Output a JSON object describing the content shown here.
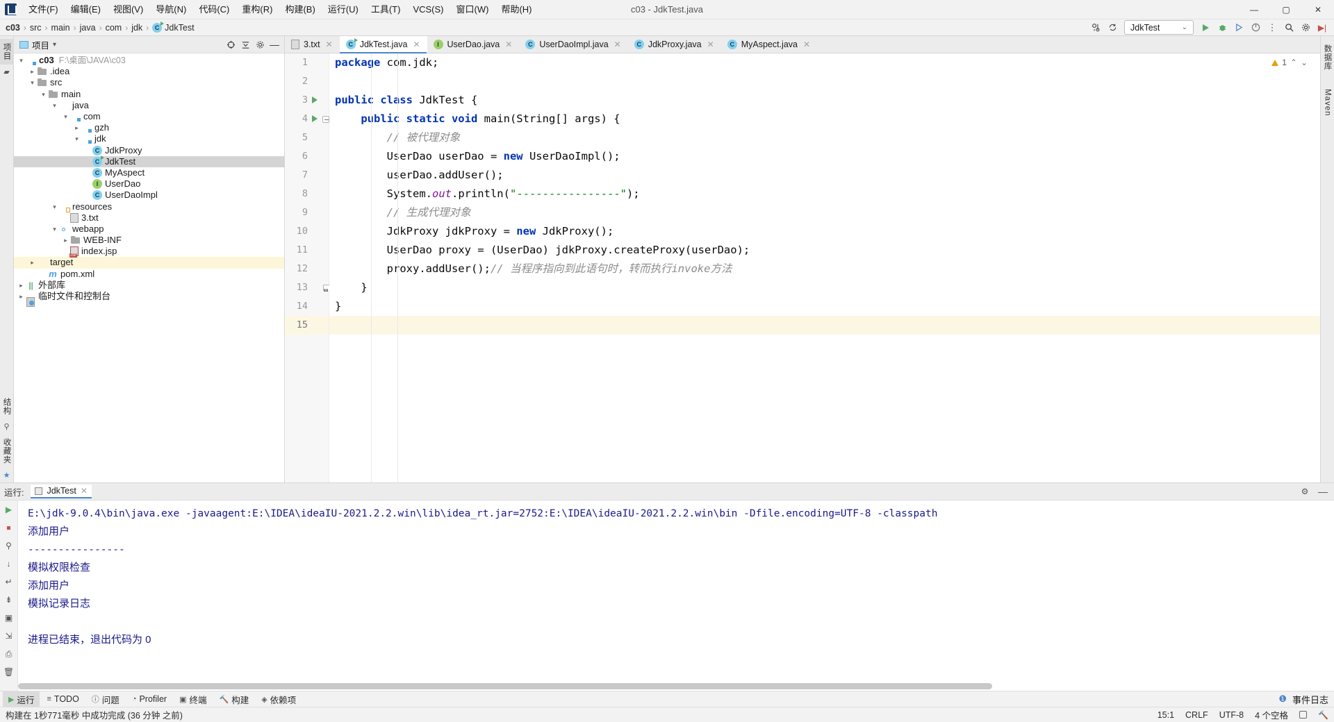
{
  "window": {
    "title": "c03 - JdkTest.java",
    "minimize": "—",
    "maximize": "▢",
    "close": "✕"
  },
  "menu": {
    "items": [
      {
        "label": "文件(F)",
        "name": "menu-file"
      },
      {
        "label": "编辑(E)",
        "name": "menu-edit"
      },
      {
        "label": "视图(V)",
        "name": "menu-view"
      },
      {
        "label": "导航(N)",
        "name": "menu-navigate"
      },
      {
        "label": "代码(C)",
        "name": "menu-code"
      },
      {
        "label": "重构(R)",
        "name": "menu-refactor"
      },
      {
        "label": "构建(B)",
        "name": "menu-build"
      },
      {
        "label": "运行(U)",
        "name": "menu-run"
      },
      {
        "label": "工具(T)",
        "name": "menu-tools"
      },
      {
        "label": "VCS(S)",
        "name": "menu-vcs"
      },
      {
        "label": "窗口(W)",
        "name": "menu-window"
      },
      {
        "label": "帮助(H)",
        "name": "menu-help"
      }
    ]
  },
  "breadcrumb": {
    "items": [
      "c03",
      "src",
      "main",
      "java",
      "com",
      "jdk",
      "JdkTest"
    ],
    "separator": "›"
  },
  "navbar_right": {
    "run_config": "JdkTest",
    "chevron": "⌄",
    "icons": [
      {
        "name": "settings-sync-icon",
        "glyph": "⇅"
      },
      {
        "name": "search-everywhere-icon",
        "glyph": "🔍"
      },
      {
        "name": "run-icon",
        "glyph": "▶"
      },
      {
        "name": "debug-icon",
        "glyph": "🐞"
      },
      {
        "name": "run-coverage-icon",
        "glyph": "▶"
      },
      {
        "name": "profiler-icon",
        "glyph": "◉"
      },
      {
        "name": "more-icon",
        "glyph": "⋮"
      },
      {
        "name": "settings-icon",
        "glyph": "⚙"
      },
      {
        "name": "updates-icon",
        "glyph": "↻"
      }
    ]
  },
  "left_strip": {
    "project_tab": "项目",
    "structure_tab": "结构",
    "favorites_tab": "收藏夹"
  },
  "right_strip": {
    "database_tab": "数据库",
    "maven_tab": "Maven"
  },
  "project_panel": {
    "title": "项目",
    "dropdown": "▾",
    "actions": [
      {
        "name": "select-opened-file-icon",
        "glyph": "⊕"
      },
      {
        "name": "collapse-all-icon",
        "glyph": "⇱"
      },
      {
        "name": "settings-icon",
        "glyph": "⚙"
      },
      {
        "name": "hide-icon",
        "glyph": "—"
      }
    ],
    "tree": [
      {
        "label": "c03",
        "path": "F:\\桌面\\JAVA\\c03",
        "icon": "folder-mod",
        "indent": 0,
        "arrow": "⌄",
        "bold": true
      },
      {
        "label": ".idea",
        "icon": "folder",
        "indent": 1,
        "arrow": "›"
      },
      {
        "label": "src",
        "icon": "folder",
        "indent": 1,
        "arrow": "⌄"
      },
      {
        "label": "main",
        "icon": "folder",
        "indent": 2,
        "arrow": "⌄"
      },
      {
        "label": "java",
        "icon": "folder-src",
        "indent": 3,
        "arrow": "⌄"
      },
      {
        "label": "com",
        "icon": "folder-mod",
        "indent": 4,
        "arrow": "⌄"
      },
      {
        "label": "gzh",
        "icon": "folder-mod",
        "indent": 5,
        "arrow": "›"
      },
      {
        "label": "jdk",
        "icon": "folder-mod",
        "indent": 5,
        "arrow": "⌄"
      },
      {
        "label": "JdkProxy",
        "icon": "class",
        "indent": 6,
        "arrow": ""
      },
      {
        "label": "JdkTest",
        "icon": "class-runnable",
        "indent": 6,
        "arrow": "",
        "selected": true
      },
      {
        "label": "MyAspect",
        "icon": "class",
        "indent": 6,
        "arrow": ""
      },
      {
        "label": "UserDao",
        "icon": "interface",
        "indent": 6,
        "arrow": ""
      },
      {
        "label": "UserDaoImpl",
        "icon": "class",
        "indent": 6,
        "arrow": ""
      },
      {
        "label": "resources",
        "icon": "folder-res",
        "indent": 3,
        "arrow": "⌄"
      },
      {
        "label": "3.txt",
        "icon": "file",
        "indent": 4,
        "arrow": ""
      },
      {
        "label": "webapp",
        "icon": "folder-web",
        "indent": 3,
        "arrow": "⌄"
      },
      {
        "label": "WEB-INF",
        "icon": "folder",
        "indent": 4,
        "arrow": "›"
      },
      {
        "label": "index.jsp",
        "icon": "jsp",
        "indent": 4,
        "arrow": ""
      },
      {
        "label": "target",
        "icon": "folder-orange",
        "indent": 1,
        "arrow": "›",
        "highlight": true
      },
      {
        "label": "pom.xml",
        "icon": "maven",
        "indent": 2,
        "arrow": ""
      },
      {
        "label": "外部库",
        "icon": "library",
        "indent": 0,
        "arrow": "›"
      },
      {
        "label": "临时文件和控制台",
        "icon": "scratch",
        "indent": 0,
        "arrow": "›"
      }
    ]
  },
  "editor_tabs": [
    {
      "label": "3.txt",
      "icon": "file",
      "active": false
    },
    {
      "label": "JdkTest.java",
      "icon": "class-runnable",
      "active": true
    },
    {
      "label": "UserDao.java",
      "icon": "interface",
      "active": false
    },
    {
      "label": "UserDaoImpl.java",
      "icon": "class",
      "active": false
    },
    {
      "label": "JdkProxy.java",
      "icon": "class",
      "active": false
    },
    {
      "label": "MyAspect.java",
      "icon": "class",
      "active": false
    }
  ],
  "editor": {
    "warning_count": "1",
    "warning_up": "⌃",
    "warning_down": "⌄",
    "lines": [
      {
        "n": "1",
        "segments": [
          {
            "t": "package",
            "c": "kw"
          },
          {
            "t": " com.jdk;",
            "c": "plain"
          }
        ]
      },
      {
        "n": "2",
        "segments": []
      },
      {
        "n": "3",
        "run": true,
        "segments": [
          {
            "t": "public class ",
            "c": "kw"
          },
          {
            "t": "JdkTest ",
            "c": "plain"
          },
          {
            "t": "{",
            "c": "plain"
          }
        ]
      },
      {
        "n": "4",
        "run": true,
        "fold": true,
        "segments": [
          {
            "t": "    public static void ",
            "c": "kw"
          },
          {
            "t": "main(String[] args) {",
            "c": "plain"
          }
        ]
      },
      {
        "n": "5",
        "segments": [
          {
            "t": "        // 被代理对象",
            "c": "cmt"
          }
        ]
      },
      {
        "n": "6",
        "segments": [
          {
            "t": "        UserDao userDao = ",
            "c": "plain"
          },
          {
            "t": "new",
            "c": "kw"
          },
          {
            "t": " UserDaoImpl();",
            "c": "plain"
          }
        ]
      },
      {
        "n": "7",
        "segments": [
          {
            "t": "        userDao.addUser();",
            "c": "plain"
          }
        ]
      },
      {
        "n": "8",
        "segments": [
          {
            "t": "        System.",
            "c": "plain"
          },
          {
            "t": "out",
            "c": "fld"
          },
          {
            "t": ".println(",
            "c": "plain"
          },
          {
            "t": "\"----------------\"",
            "c": "str"
          },
          {
            "t": ");",
            "c": "plain"
          }
        ]
      },
      {
        "n": "9",
        "segments": [
          {
            "t": "        // 生成代理对象",
            "c": "cmt"
          }
        ]
      },
      {
        "n": "10",
        "segments": [
          {
            "t": "        JdkProxy jdkProxy = ",
            "c": "plain"
          },
          {
            "t": "new",
            "c": "kw"
          },
          {
            "t": " JdkProxy();",
            "c": "plain"
          }
        ]
      },
      {
        "n": "11",
        "segments": [
          {
            "t": "        UserDao proxy = (UserDao) jdkProxy.createProxy(userDao);",
            "c": "plain"
          }
        ]
      },
      {
        "n": "12",
        "segments": [
          {
            "t": "        proxy.addUser();",
            "c": "plain"
          },
          {
            "t": "// 当程序指向到此语句时，转而执行invoke方法",
            "c": "cmt"
          }
        ]
      },
      {
        "n": "13",
        "foldend": true,
        "segments": [
          {
            "t": "    }",
            "c": "plain"
          }
        ]
      },
      {
        "n": "14",
        "segments": [
          {
            "t": "}",
            "c": "plain"
          }
        ]
      },
      {
        "n": "15",
        "cur": true,
        "segments": []
      }
    ]
  },
  "run_panel": {
    "label": "运行:",
    "tab": "JdkTest",
    "tab_close": "✕",
    "settings_icon": "⚙",
    "hide_icon": "—",
    "toolbar": [
      {
        "name": "rerun-icon",
        "glyph": "▶",
        "color": "green"
      },
      {
        "name": "stop-icon",
        "glyph": "⏹",
        "color": "red"
      },
      {
        "name": "pin-icon",
        "glyph": "⚲"
      },
      {
        "name": "scroll-down-icon",
        "glyph": "↓"
      },
      {
        "name": "soft-wrap-icon",
        "glyph": "↵"
      },
      {
        "name": "print-settings-icon",
        "glyph": "⇟"
      },
      {
        "name": "screenshot-icon",
        "glyph": "▣"
      },
      {
        "name": "export-icon",
        "glyph": "⇲"
      },
      {
        "name": "print-icon",
        "glyph": "⎙"
      },
      {
        "name": "clear-all-icon",
        "glyph": "🗑"
      }
    ],
    "console_lines": [
      {
        "text": "E:\\jdk-9.0.4\\bin\\java.exe -javaagent:E:\\IDEA\\ideaIU-2021.2.2.win\\lib\\idea_rt.jar=2752:E:\\IDEA\\ideaIU-2021.2.2.win\\bin -Dfile.encoding=UTF-8 -classpath",
        "cjk": false
      },
      {
        "text": "添加用户",
        "cjk": true
      },
      {
        "text": "----------------",
        "cjk": false
      },
      {
        "text": "模拟权限检查",
        "cjk": true
      },
      {
        "text": "添加用户",
        "cjk": true
      },
      {
        "text": "模拟记录日志",
        "cjk": true
      },
      {
        "text": "",
        "cjk": false
      },
      {
        "text": "进程已结束，退出代码为 0",
        "cjk": true
      }
    ]
  },
  "bottom_bar": {
    "items": [
      {
        "label": "运行",
        "icon": "▶",
        "name": "bottom-tab-run",
        "selected": true
      },
      {
        "label": "TODO",
        "icon": "≡",
        "name": "bottom-tab-todo"
      },
      {
        "label": "问题",
        "icon": "ⓘ",
        "name": "bottom-tab-problems"
      },
      {
        "label": "Profiler",
        "icon": "◔",
        "name": "bottom-tab-profiler"
      },
      {
        "label": "终端",
        "icon": "▣",
        "name": "bottom-tab-terminal"
      },
      {
        "label": "构建",
        "icon": "🔨",
        "name": "bottom-tab-build"
      },
      {
        "label": "依赖项",
        "icon": "◈",
        "name": "bottom-tab-dependencies"
      }
    ],
    "event_log": "事件日志"
  },
  "status_bar": {
    "message": "构建在 1秒771毫秒 中成功完成 (36 分钟 之前)",
    "caret": "15:1",
    "line_sep": "CRLF",
    "encoding": "UTF-8",
    "indent": "4 个空格",
    "lock": "lock-icon",
    "hammer": "hammer-icon"
  }
}
